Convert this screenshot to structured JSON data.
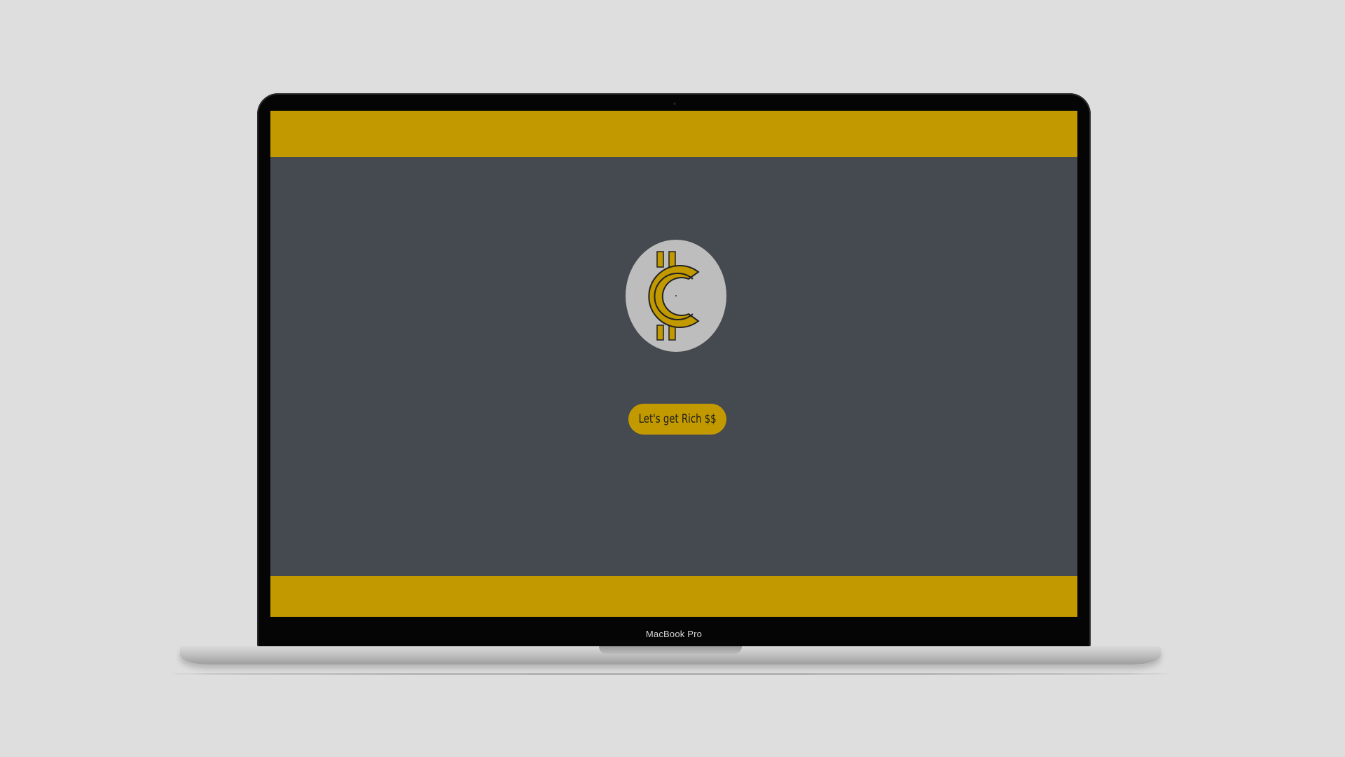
{
  "device": {
    "model_label": "MacBook Pro"
  },
  "page": {
    "logo": {
      "icon": "coin-c-logo-icon"
    },
    "cta_button": {
      "label": "Let's get Rich $$"
    }
  },
  "colors": {
    "accent": "#c29a00",
    "background": "#454950",
    "logo_circle": "#bdbdbd",
    "outer_background": "#dedede"
  }
}
